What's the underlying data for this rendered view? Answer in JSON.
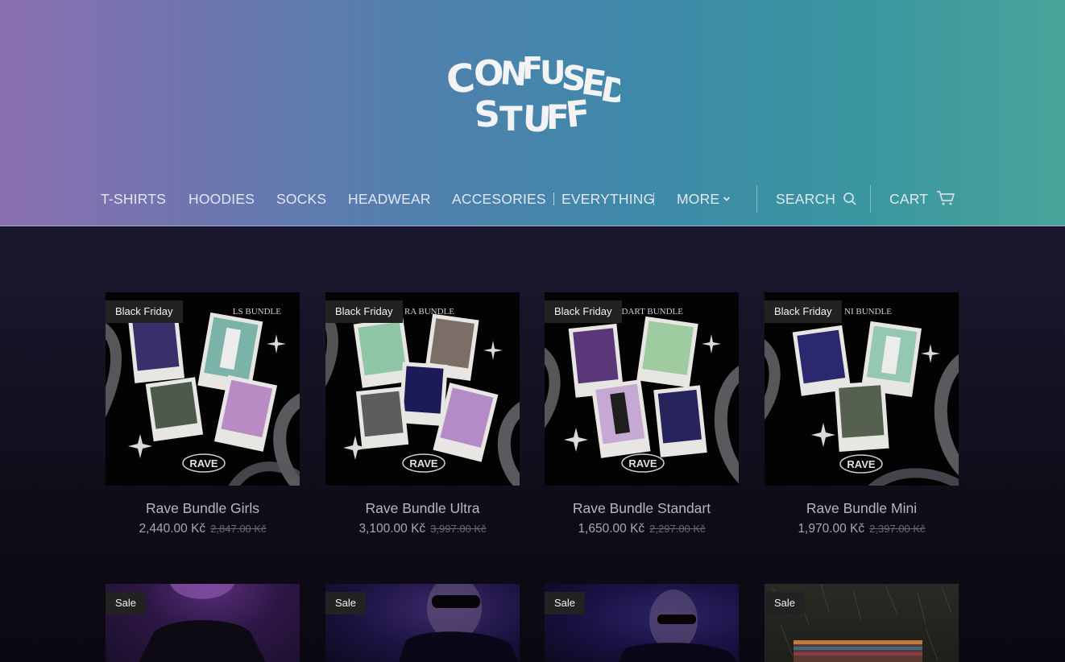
{
  "brand": {
    "logo_text": "CONFUSED STUFF"
  },
  "nav": {
    "items": [
      "T-SHIRTS",
      "HOODIES",
      "SOCKS",
      "HEADWEAR",
      "ACCESORIES",
      "EVERYTHING",
      "MORE"
    ],
    "search_label": "SEARCH",
    "cart_label": "CART"
  },
  "products": [
    {
      "badge": "Black Friday",
      "image_caption": "LS BUNDLE",
      "image_logo": "RAVE",
      "title": "Rave Bundle Girls",
      "price": "2,440.00 Kč",
      "old_price": "2,847.00 Kč"
    },
    {
      "badge": "Black Friday",
      "image_caption": "RA BUNDLE",
      "image_logo": "RAVE",
      "title": "Rave Bundle Ultra",
      "price": "3,100.00 Kč",
      "old_price": "3,997.00 Kč"
    },
    {
      "badge": "Black Friday",
      "image_caption": "DART BUNDLE",
      "image_logo": "RAVE",
      "title": "Rave Bundle Standart",
      "price": "1,650.00 Kč",
      "old_price": "2,297.00 Kč"
    },
    {
      "badge": "Black Friday",
      "image_caption": "NI BUNDLE",
      "image_logo": "RAVE",
      "title": "Rave Bundle Mini",
      "price": "1,970.00 Kč",
      "old_price": "2,397.00 Kč"
    }
  ],
  "products_row2": [
    {
      "badge": "Sale"
    },
    {
      "badge": "Sale"
    },
    {
      "badge": "Sale"
    },
    {
      "badge": "Sale"
    }
  ],
  "colors": {
    "header_gradient_start": "#8b6fb0",
    "header_gradient_end": "#4aa39a",
    "page_background": "#1a162c",
    "badge_background": "#222222"
  },
  "icons": {
    "search": "search-icon",
    "cart": "cart-icon",
    "more": "chevron-down-icon"
  }
}
